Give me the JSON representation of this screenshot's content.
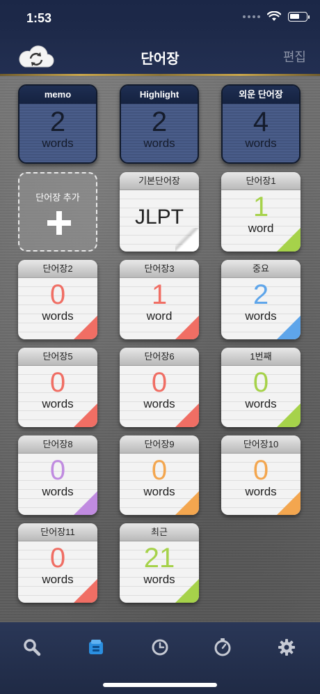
{
  "status": {
    "time": "1:53",
    "battery_level": 0.6
  },
  "nav": {
    "title": "단어장",
    "edit_label": "편집"
  },
  "colors": {
    "red": "#f06e64",
    "orange": "#f3a64f",
    "purple": "#c08be0",
    "green": "#a6d24a",
    "blue": "#5ea5ea",
    "white": "#ffffff"
  },
  "special_lists": [
    {
      "title": "memo",
      "count": "2",
      "unit": "words"
    },
    {
      "title": "Highlight",
      "count": "2",
      "unit": "words"
    },
    {
      "title": "외운 단어장",
      "count": "4",
      "unit": "words"
    }
  ],
  "add_tile": {
    "label": "단어장 추가"
  },
  "default_list": {
    "title": "기본단어장",
    "content": "JLPT"
  },
  "lists": [
    {
      "title": "단어장1",
      "count": "1",
      "unit": "word",
      "color": "green"
    },
    {
      "title": "단어장2",
      "count": "0",
      "unit": "words",
      "color": "red"
    },
    {
      "title": "단어장3",
      "count": "1",
      "unit": "word",
      "color": "red"
    },
    {
      "title": "중요",
      "count": "2",
      "unit": "words",
      "color": "blue"
    },
    {
      "title": "단어장5",
      "count": "0",
      "unit": "words",
      "color": "red"
    },
    {
      "title": "단어장6",
      "count": "0",
      "unit": "words",
      "color": "red"
    },
    {
      "title": "1번째",
      "count": "0",
      "unit": "words",
      "color": "green"
    },
    {
      "title": "단어장8",
      "count": "0",
      "unit": "words",
      "color": "purple"
    },
    {
      "title": "단어장9",
      "count": "0",
      "unit": "words",
      "color": "orange"
    },
    {
      "title": "단어장10",
      "count": "0",
      "unit": "words",
      "color": "orange"
    },
    {
      "title": "단어장11",
      "count": "0",
      "unit": "words",
      "color": "red"
    },
    {
      "title": "최근",
      "count": "21",
      "unit": "words",
      "color": "green"
    }
  ],
  "tabs": [
    {
      "icon": "search-icon",
      "active": false
    },
    {
      "icon": "word-list-icon",
      "active": true
    },
    {
      "icon": "history-clock-icon",
      "active": false
    },
    {
      "icon": "timer-icon",
      "active": false
    },
    {
      "icon": "gear-icon",
      "active": false
    }
  ]
}
